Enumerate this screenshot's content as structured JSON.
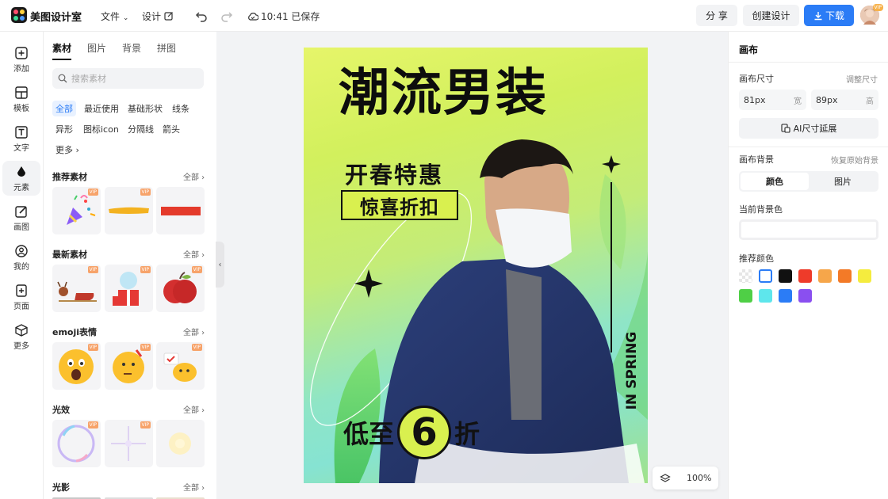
{
  "app": {
    "name": "美图设计室"
  },
  "topbar": {
    "file_menu": "文件",
    "design_menu": "设计",
    "save_status": "10:41 已保存",
    "share_label": "分 享",
    "create_label": "创建设计",
    "download_label": "下载",
    "avatar_badge": "VIP"
  },
  "rail": {
    "items": [
      {
        "label": "添加",
        "icon": "plus-square-icon"
      },
      {
        "label": "模板",
        "icon": "template-icon"
      },
      {
        "label": "文字",
        "icon": "text-icon"
      },
      {
        "label": "元素",
        "icon": "element-icon"
      },
      {
        "label": "画图",
        "icon": "draw-icon"
      },
      {
        "label": "我的",
        "icon": "user-icon"
      },
      {
        "label": "页面",
        "icon": "page-add-icon"
      },
      {
        "label": "更多",
        "icon": "cube-icon"
      }
    ],
    "active_index": 3
  },
  "materials": {
    "tabs": [
      "素材",
      "图片",
      "背景",
      "拼图"
    ],
    "active_tab": 0,
    "search_placeholder": "搜索素材",
    "chips": [
      "全部",
      "最近使用",
      "基础形状",
      "线条",
      "异形",
      "图标icon",
      "分隔线",
      "箭头",
      "更多"
    ],
    "active_chip": 0,
    "all_label": "全部",
    "vip_badge": "VIP",
    "sections": [
      {
        "title": "推荐素材",
        "tiles": [
          "party-popper",
          "yellow-brush-stroke",
          "red-bar"
        ]
      },
      {
        "title": "最新素材",
        "tiles": [
          "reindeer-sleigh",
          "snow-globe-gift",
          "red-apple"
        ]
      },
      {
        "title": "emoji表情",
        "tiles": [
          "scared-emoji",
          "thinking-emoji",
          "chick-emoji"
        ]
      },
      {
        "title": "光效",
        "tiles": [
          "bubble-ring",
          "sparkle-star",
          "glow-flare"
        ]
      },
      {
        "title": "光影",
        "tiles": []
      }
    ]
  },
  "poster": {
    "title": "潮流男装",
    "sub1": "开春特惠",
    "sub2": "惊喜折扣",
    "sale_prefix": "低至",
    "sale_number": "6",
    "sale_suffix": "折",
    "vertical_text": "IN SPRING"
  },
  "canvas": {
    "zoom": "100%"
  },
  "inspector": {
    "title": "画布",
    "size_label": "画布尺寸",
    "resize_link": "调整尺寸",
    "width_value": "81px",
    "width_unit": "宽",
    "height_value": "89px",
    "height_unit": "高",
    "ai_extend": "AI尺寸延展",
    "bg_label": "画布背景",
    "restore_link": "恢复原始背景",
    "seg_color": "颜色",
    "seg_image": "图片",
    "current_bg_label": "当前背景色",
    "recommend_label": "推荐颜色",
    "swatches": [
      "transparent",
      "#ffffff",
      "#111111",
      "#ee3b2a",
      "#f6a64a",
      "#f37a27",
      "#f5ec3e",
      "#4fcf46",
      "#5ee6ec",
      "#2b7cf6",
      "#8a4ff0"
    ]
  }
}
